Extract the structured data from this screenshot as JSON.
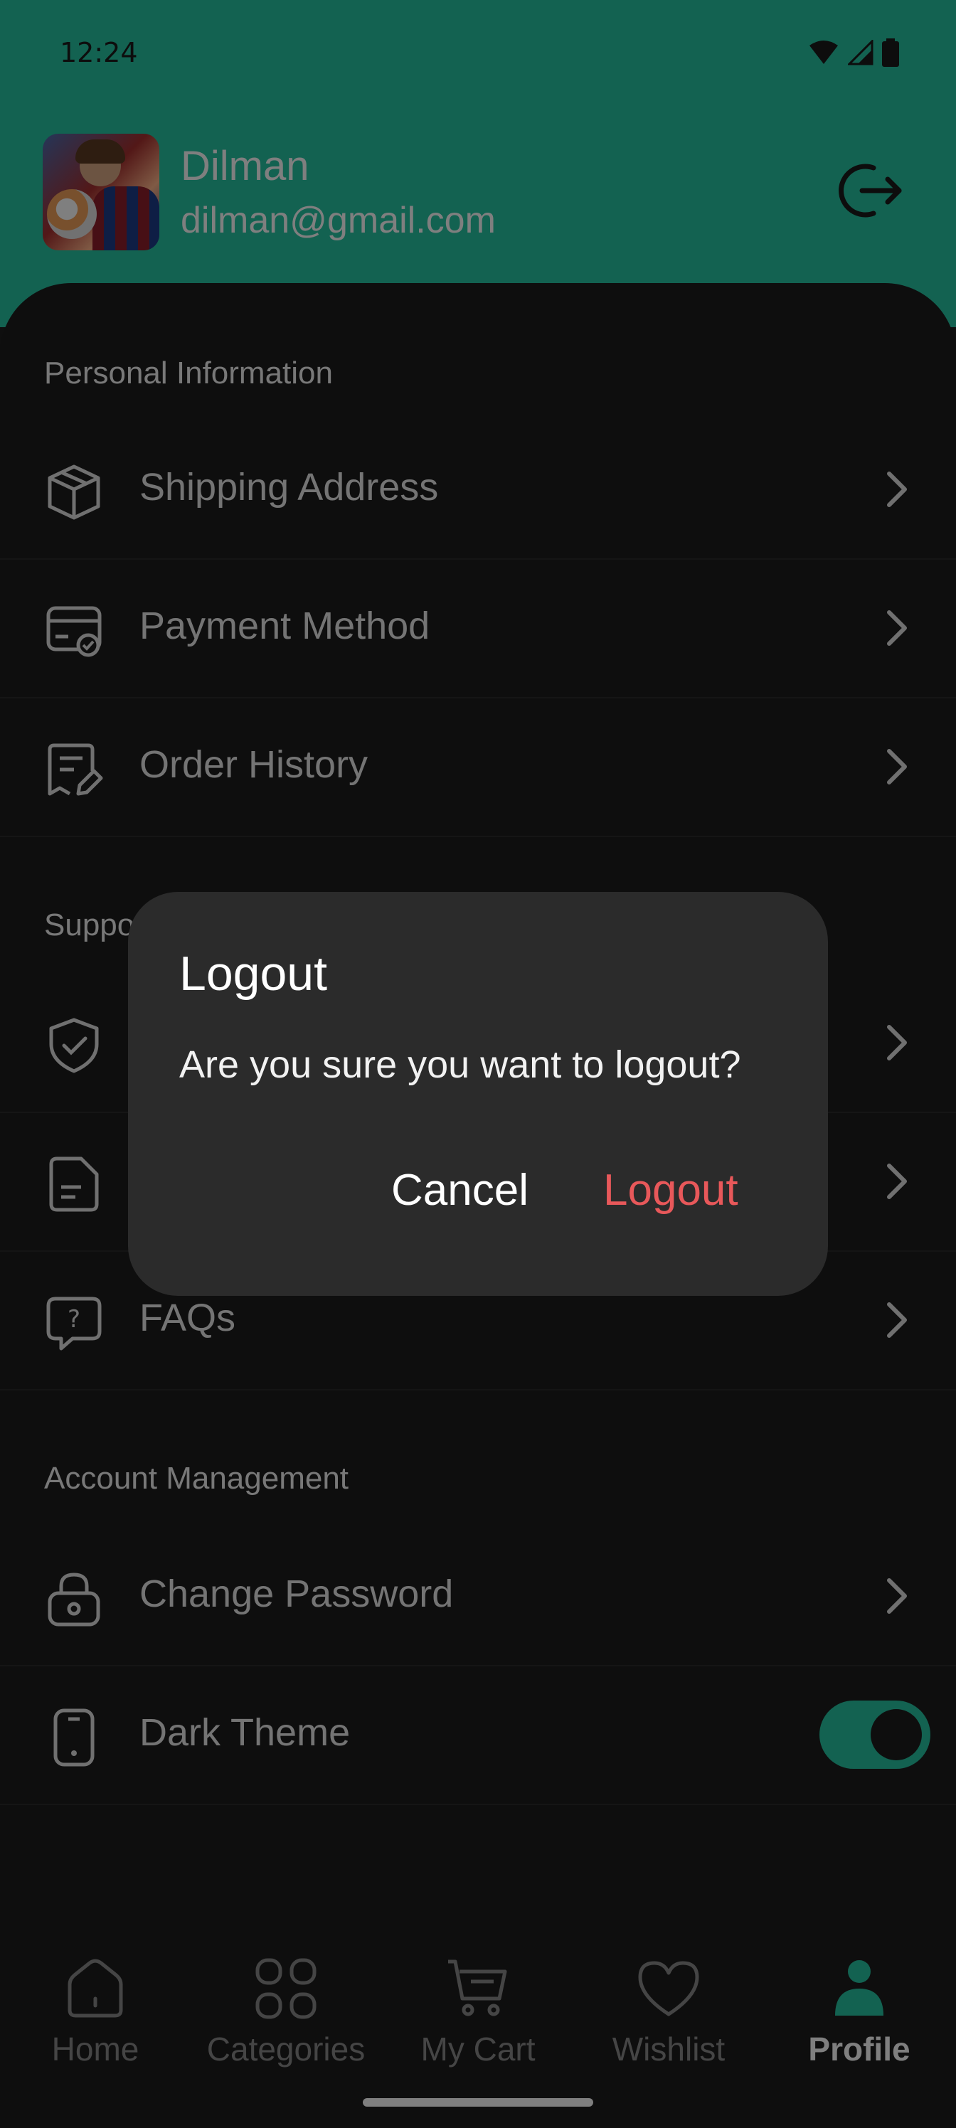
{
  "status_bar": {
    "time": "12:24"
  },
  "profile": {
    "name": "Dilman",
    "email": "dilman@gmail.com"
  },
  "sections": [
    {
      "title": "Personal Information",
      "items": [
        {
          "label": "Shipping Address",
          "icon": "package-icon"
        },
        {
          "label": "Payment Method",
          "icon": "card-check-icon"
        },
        {
          "label": "Order History",
          "icon": "receipt-edit-icon"
        }
      ]
    },
    {
      "title": "Suppo",
      "items": [
        {
          "label": "",
          "icon": "shield-check-icon"
        },
        {
          "label": "",
          "icon": "document-icon"
        },
        {
          "label": "FAQs",
          "icon": "question-chat-icon"
        }
      ]
    },
    {
      "title": "Account Management",
      "items": [
        {
          "label": "Change Password",
          "icon": "lock-icon"
        },
        {
          "label": "Dark Theme",
          "icon": "phone-icon"
        }
      ]
    }
  ],
  "dark_theme_enabled": true,
  "dialog": {
    "title": "Logout",
    "message": "Are you sure you want to logout?",
    "cancel_label": "Cancel",
    "confirm_label": "Logout"
  },
  "nav": [
    {
      "label": "Home",
      "icon": "home-icon"
    },
    {
      "label": "Categories",
      "icon": "grid-icon"
    },
    {
      "label": "My Cart",
      "icon": "cart-icon"
    },
    {
      "label": "Wishlist",
      "icon": "heart-icon"
    },
    {
      "label": "Profile",
      "icon": "person-icon",
      "active": true
    }
  ],
  "colors": {
    "accent": "#27c4a3",
    "danger": "#e8585a",
    "surface": "#1d1d1d"
  }
}
